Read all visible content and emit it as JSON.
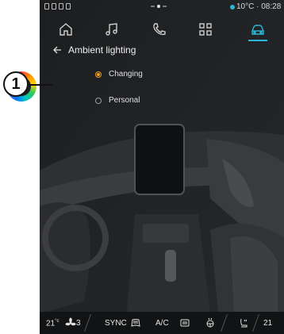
{
  "callout": {
    "number": "1"
  },
  "status_bar": {
    "outside_temp": "10°C · 08:28"
  },
  "top_nav": {
    "items": [
      {
        "icon": "home-icon",
        "active": false
      },
      {
        "icon": "music-note-icon",
        "active": false
      },
      {
        "icon": "phone-icon",
        "active": false
      },
      {
        "icon": "apps-grid-icon",
        "active": false
      },
      {
        "icon": "car-icon",
        "active": true
      }
    ],
    "active_color": "#2bb6d8"
  },
  "header": {
    "title": "Ambient lighting"
  },
  "options": [
    {
      "label": "Changing",
      "selected": true
    },
    {
      "label": "Personal",
      "selected": false
    }
  ],
  "accent_color": "#f0a020",
  "bottom_bar": {
    "left_temp": "21",
    "left_unit": "°c",
    "fan_level": "3",
    "sync_label": "SYNC",
    "ac_label": "A/C",
    "right_temp": "21"
  }
}
